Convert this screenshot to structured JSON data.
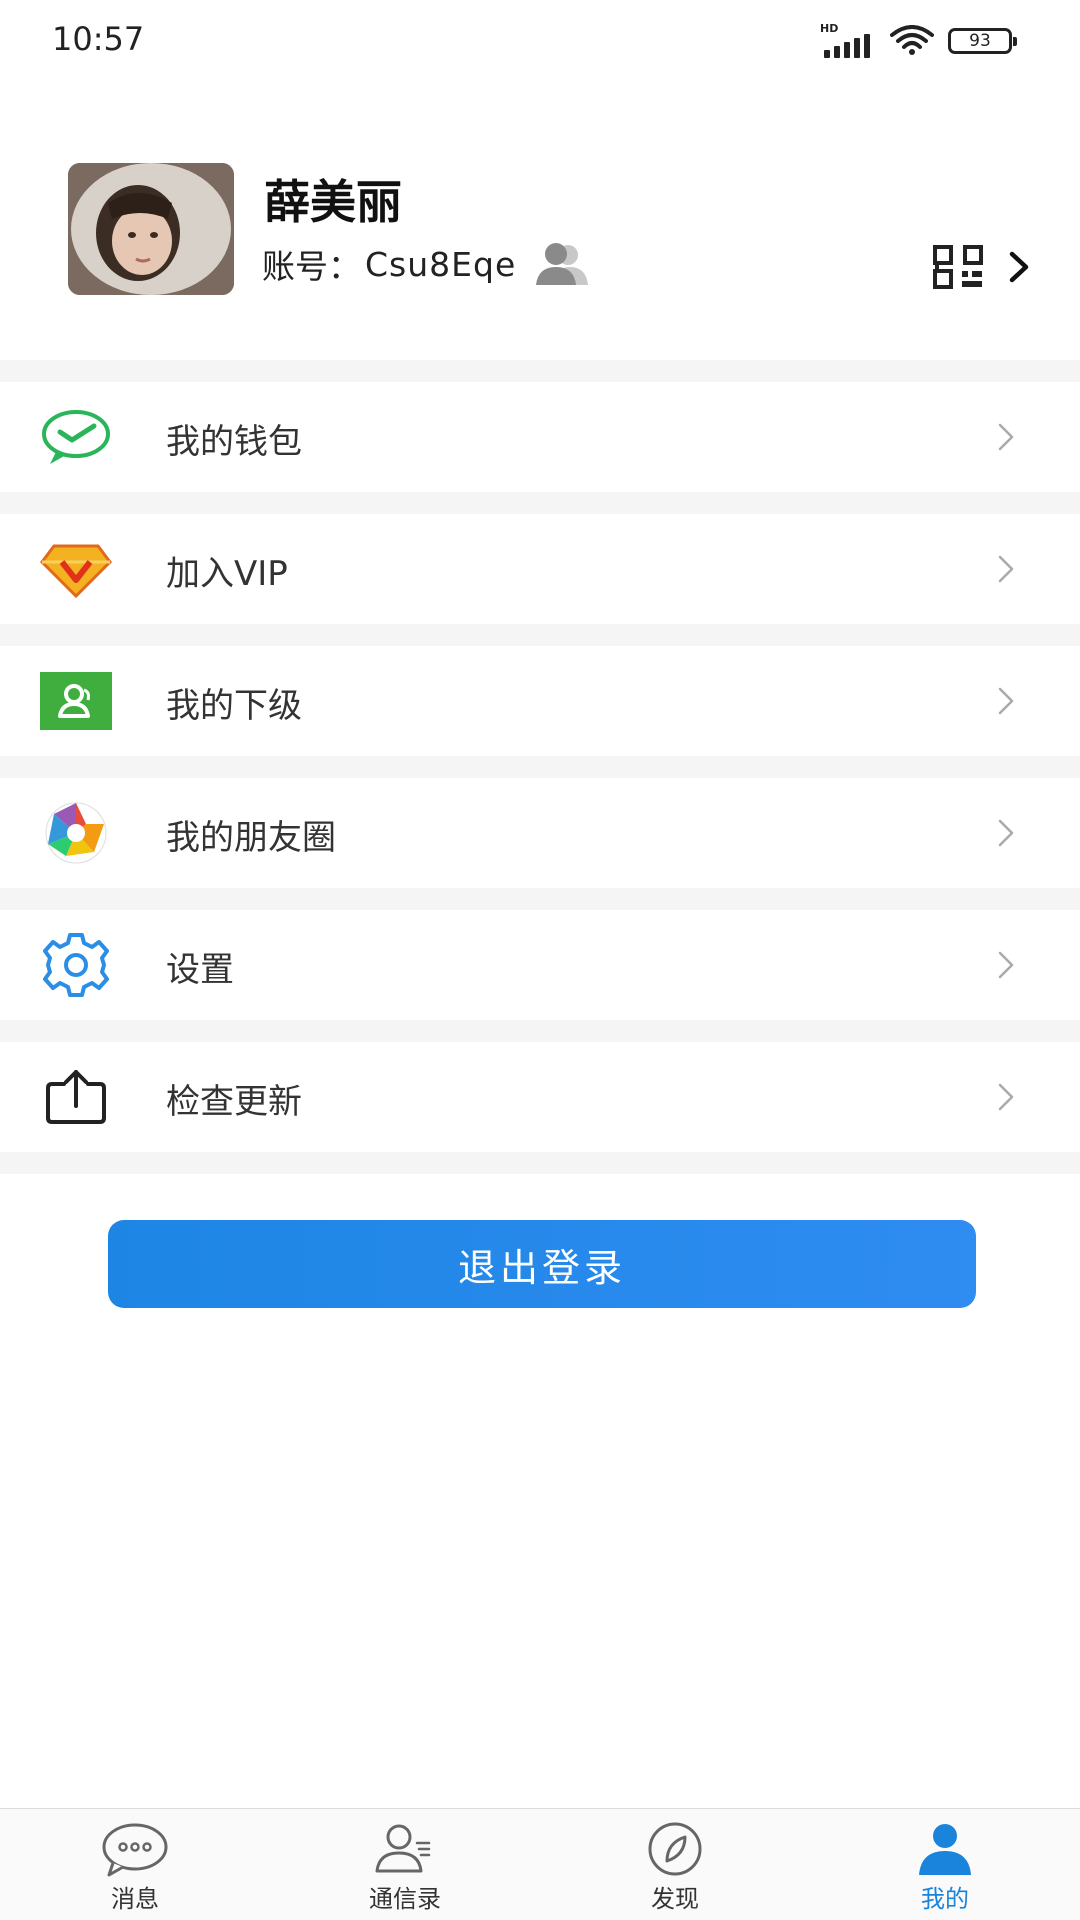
{
  "status_bar": {
    "time": "10:57",
    "network_label": "HD",
    "battery": "93"
  },
  "profile": {
    "name": "薛美丽",
    "account_label": "账号：",
    "account_id": "Csu8Eqe",
    "avatar_icon": "avatar-photo",
    "qr_icon": "qr-code-icon"
  },
  "menu": {
    "items": [
      {
        "label": "我的钱包",
        "icon": "wallet-icon",
        "color": "#2ab55a"
      },
      {
        "label": "加入VIP",
        "icon": "vip-diamond-icon",
        "color": "#f0a020"
      },
      {
        "label": "我的下级",
        "icon": "subordinate-icon",
        "color": "#3fae3f"
      },
      {
        "label": "我的朋友圈",
        "icon": "moments-icon",
        "color": "#e84c3c"
      },
      {
        "label": "设置",
        "icon": "settings-icon",
        "color": "#2b8ee6"
      },
      {
        "label": "检查更新",
        "icon": "update-icon",
        "color": "#222222"
      }
    ]
  },
  "logout_label": "退出登录",
  "bottom_nav": {
    "items": [
      {
        "label": "消息",
        "icon": "message-icon",
        "active": false
      },
      {
        "label": "通信录",
        "icon": "contacts-icon",
        "active": false
      },
      {
        "label": "发现",
        "icon": "discover-icon",
        "active": false
      },
      {
        "label": "我的",
        "icon": "me-icon",
        "active": true
      }
    ]
  },
  "colors": {
    "accent": "#1a84dc",
    "button_blue": "#2f8cf1",
    "section_bg": "#f5f5f5"
  }
}
